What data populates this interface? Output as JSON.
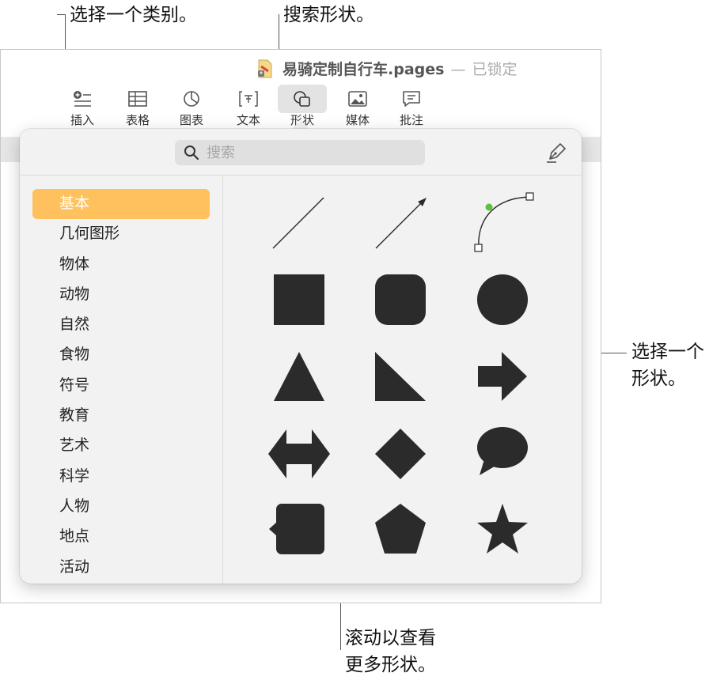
{
  "callouts": {
    "select_category": "选择一个类别。",
    "search_shapes": "搜索形状。",
    "select_shape_line1": "选择一个",
    "select_shape_line2": "形状。",
    "scroll_line1": "滚动以查看",
    "scroll_line2": "更多形状。"
  },
  "window": {
    "doc_name": "易骑定制自行车.pages",
    "separator": "—",
    "locked": "已锁定"
  },
  "toolbar": [
    {
      "label": "插入",
      "icon": "insert-icon"
    },
    {
      "label": "表格",
      "icon": "table-icon"
    },
    {
      "label": "图表",
      "icon": "chart-icon"
    },
    {
      "label": "文本",
      "icon": "text-icon"
    },
    {
      "label": "形状",
      "icon": "shape-icon",
      "active": true
    },
    {
      "label": "媒体",
      "icon": "media-icon"
    },
    {
      "label": "批注",
      "icon": "comment-icon"
    }
  ],
  "shapes_popover": {
    "search_placeholder": "搜索",
    "categories": [
      "基本",
      "几何图形",
      "物体",
      "动物",
      "自然",
      "食物",
      "符号",
      "教育",
      "艺术",
      "科学",
      "人物",
      "地点",
      "活动"
    ],
    "selected_category": "基本",
    "shapes": [
      "line",
      "arrow-line",
      "curve",
      "square",
      "rounded-square",
      "circle",
      "triangle",
      "right-triangle",
      "arrow",
      "double-arrow",
      "diamond",
      "speech-bubble",
      "callout-square",
      "pentagon",
      "star"
    ]
  },
  "colors": {
    "selected_category_bg": "#fec15e",
    "shape_fill": "#2b2b2b",
    "curve_handle": "#5ac13c"
  }
}
